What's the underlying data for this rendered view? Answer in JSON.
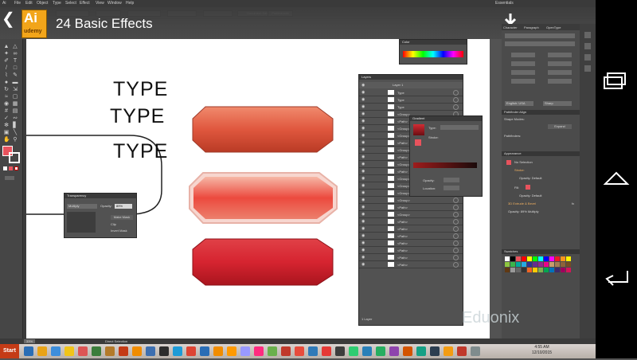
{
  "menu": {
    "items": [
      "Ai",
      "File",
      "Edit",
      "Object",
      "Type",
      "Select",
      "Effect",
      "View",
      "Window",
      "Help"
    ],
    "workspace": "Essentials"
  },
  "control_bar": {
    "document_setup": "Document Setup",
    "preferences": "Preferences"
  },
  "overlay": {
    "logo_letters": "Ai",
    "logo_brand": "udemy",
    "lesson_title": "24  Basic Effects"
  },
  "canvas": {
    "type_words": [
      "TYPE",
      "TYPE",
      "TYPE"
    ],
    "button_colors": {
      "top": "#e0573e",
      "middle": "#ec4a3e",
      "bottom": "#d62430"
    }
  },
  "transparency_panel": {
    "title": "Transparency",
    "blend_mode": "Multiply",
    "opacity_label": "Opacity:",
    "opacity_value": "89%",
    "make_mask": "Make Mask",
    "clip": "Clip",
    "invert_mask": "Invert Mask"
  },
  "layers_panel": {
    "title": "Layers",
    "layer_name": "Layer 1",
    "rows": [
      "Type",
      "Type",
      "Type",
      "<Group>",
      "<Path>",
      "<Group>",
      "<Group>",
      "<Path>",
      "<Group>",
      "<Path>",
      "<Group>",
      "<Path>",
      "<Group>",
      "<Group>",
      "<Group>",
      "<Group>",
      "<Path>",
      "<Group>",
      "<Path>",
      "<Path>",
      "<Path>",
      "<Path>",
      "<Path>",
      "<Path>",
      "<Path>"
    ],
    "footer": "1 Layer"
  },
  "gradient_panel": {
    "title": "Gradient",
    "type_label": "Type:",
    "stroke_label": "Stroke:",
    "opacity_label": "Opacity:",
    "location_label": "Location:"
  },
  "color_panel": {
    "title": "Color"
  },
  "right_panel": {
    "tabs": [
      "Character",
      "Paragraph",
      "OpenType"
    ],
    "language": "English: USA",
    "sharp": "Sharp",
    "pathfinder_title": "Pathfinder",
    "align_tab": "Align",
    "shape_modes": "Shape Modes:",
    "expand": "Expand",
    "pathfinders": "Pathfinders:",
    "appearance_title": "Appearance",
    "no_selection": "No Selection",
    "stroke": "Stroke:",
    "opacity_default": "Opacity: Default",
    "fill": "Fill:",
    "inner_glow_opacity": "Opacity: Default",
    "effect_3d": "3D Extrude & Bevel",
    "opacity_multiply": "Opacity: 89% Multiply",
    "swatches_title": "Swatches",
    "fx": "fx"
  },
  "status": {
    "zoom": "33%",
    "tool": "Direct Selection"
  },
  "taskbar": {
    "start": "Start",
    "time": "4:55 AM",
    "date": "12/10/2015"
  },
  "watermark": "Eduonix",
  "colors": {
    "ai_logo": "#f2a51a",
    "swatch_red": "#e8535d"
  }
}
